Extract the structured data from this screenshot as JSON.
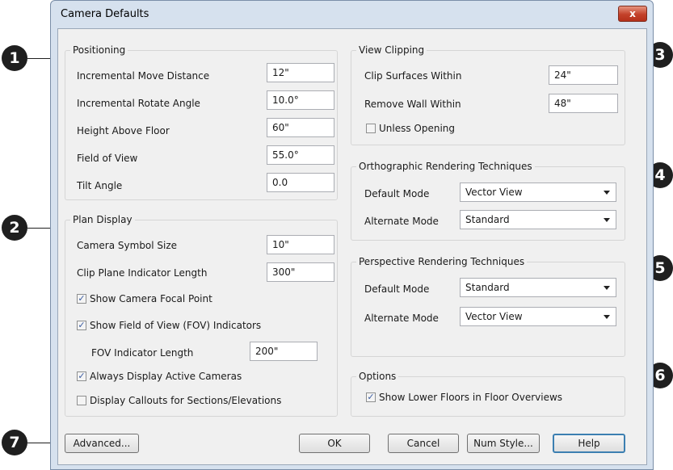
{
  "window": {
    "title": "Camera Defaults",
    "close_glyph": "x"
  },
  "callouts": [
    "1",
    "2",
    "3",
    "4",
    "5",
    "6",
    "7"
  ],
  "positioning": {
    "title": "Positioning",
    "rows": [
      {
        "label": "Incremental Move Distance",
        "value": "12\""
      },
      {
        "label": "Incremental Rotate Angle",
        "value": "10.0°"
      },
      {
        "label": "Height Above Floor",
        "value": "60\""
      },
      {
        "label": "Field of View",
        "value": "55.0°"
      },
      {
        "label": "Tilt Angle",
        "value": "0.0"
      }
    ]
  },
  "plan_display": {
    "title": "Plan Display",
    "camera_symbol_size": {
      "label": "Camera Symbol Size",
      "value": "10\""
    },
    "clip_plane_indicator_length": {
      "label": "Clip Plane Indicator Length",
      "value": "300\""
    },
    "show_camera_focal_point": {
      "label": "Show Camera Focal Point",
      "checked": true
    },
    "show_fov_indicators": {
      "label": "Show Field of View (FOV) Indicators",
      "checked": true
    },
    "fov_indicator_length": {
      "label": "FOV Indicator Length",
      "value": "200\""
    },
    "always_display_active_cameras": {
      "label": "Always Display Active Cameras",
      "checked": true
    },
    "display_callouts": {
      "label": "Display Callouts for Sections/Elevations",
      "checked": false
    }
  },
  "view_clipping": {
    "title": "View Clipping",
    "clip_surfaces": {
      "label": "Clip Surfaces Within",
      "value": "24\""
    },
    "remove_wall": {
      "label": "Remove Wall Within",
      "value": "48\""
    },
    "unless_opening": {
      "label": "Unless Opening",
      "checked": false
    }
  },
  "ortho": {
    "title": "Orthographic Rendering Techniques",
    "default_mode": {
      "label": "Default Mode",
      "value": "Vector View"
    },
    "alternate_mode": {
      "label": "Alternate Mode",
      "value": "Standard"
    }
  },
  "persp": {
    "title": "Perspective Rendering Techniques",
    "default_mode": {
      "label": "Default Mode",
      "value": "Standard"
    },
    "alternate_mode": {
      "label": "Alternate Mode",
      "value": "Vector View"
    }
  },
  "options": {
    "title": "Options",
    "show_lower_floors": {
      "label": "Show Lower Floors in Floor Overviews",
      "checked": true
    }
  },
  "buttons": {
    "advanced": "Advanced...",
    "ok": "OK",
    "cancel": "Cancel",
    "num_style": "Num Style...",
    "help": "Help"
  }
}
